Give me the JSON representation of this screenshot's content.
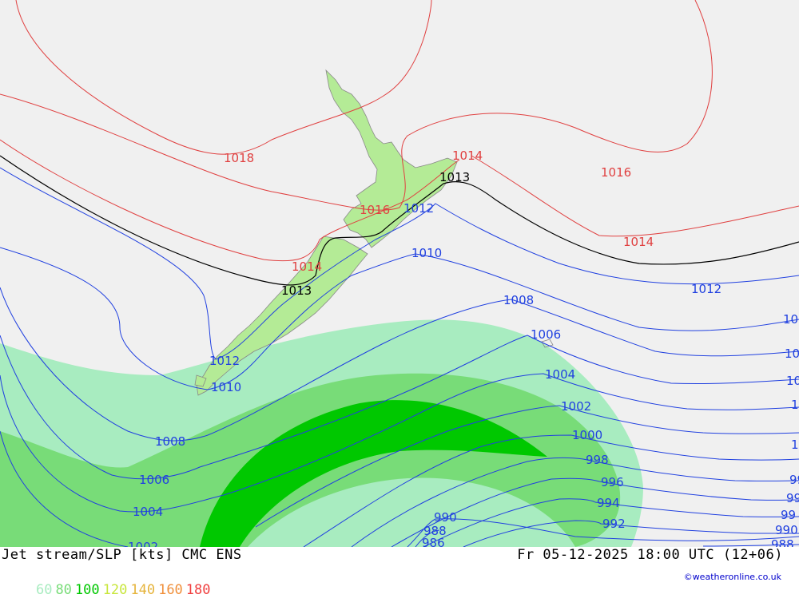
{
  "footer": {
    "title": "Jet stream/SLP [kts] CMC ENS",
    "datetime": "Fr 05-12-2025 18:00 UTC (12+06)",
    "credit": "©weatheronline.co.uk"
  },
  "legend": [
    {
      "label": "60",
      "color": "#a8ecc0"
    },
    {
      "label": "80",
      "color": "#78dc78"
    },
    {
      "label": "100",
      "color": "#00c800"
    },
    {
      "label": "120",
      "color": "#c8e63c"
    },
    {
      "label": "140",
      "color": "#e6b43c"
    },
    {
      "label": "160",
      "color": "#f0903c"
    },
    {
      "label": "180",
      "color": "#f04040"
    }
  ],
  "colors": {
    "background": "#f0f0f0",
    "land": "#b4eb96",
    "isobar_high": "#e04040",
    "isobar_ref": "#000000",
    "isobar_low": "#2040e0"
  },
  "isobar_labels": {
    "l1018": "1018",
    "l1016a": "1016",
    "l1016b": "1016",
    "l1014a": "1014",
    "l1014b": "1014",
    "l1014c": "1014",
    "l1013a": "1013",
    "l1013b": "1013",
    "l1012a": "1012",
    "l1012b": "1012",
    "l1012c": "1012",
    "l1010a": "1010",
    "l1010b": "1010",
    "l1008a": "1008",
    "l1008b": "1008",
    "l1006a": "1006",
    "l1006b": "1006",
    "l1004a": "1004",
    "l1004b": "1004",
    "l1002a": "1002",
    "l1002b": "1002",
    "l1000": "1000",
    "l998": "998",
    "l996": "996",
    "l994": "994",
    "l992": "992",
    "l990a": "990",
    "l990b": "990",
    "l988a": "988",
    "l988b": "988",
    "l986": "986",
    "r10": "10",
    "r10b": "10",
    "r10c": "10",
    "r1a": "1",
    "r1b": "1",
    "r99a": "99",
    "r99b": "99",
    "r99c": "99"
  }
}
